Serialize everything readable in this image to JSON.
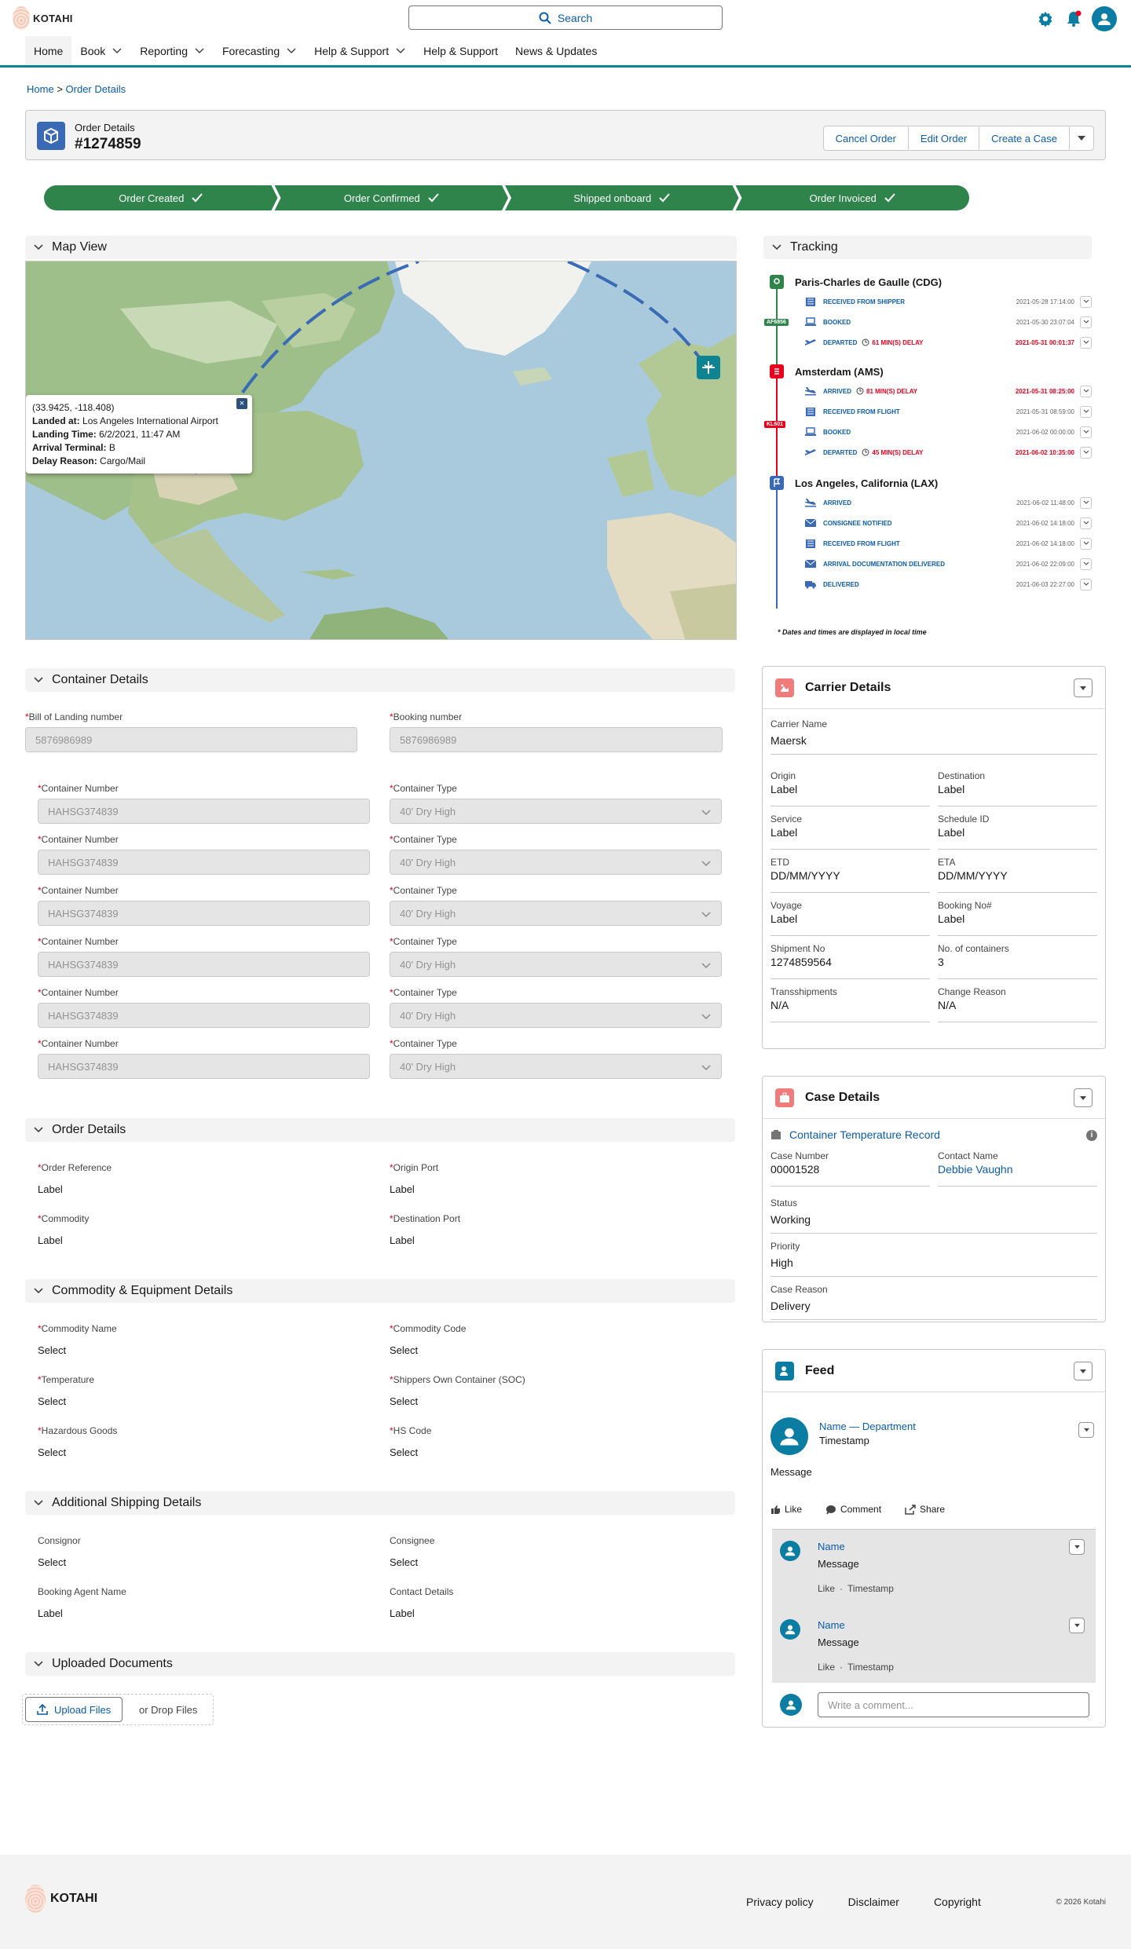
{
  "brand": {
    "name": "KOTAHI"
  },
  "header": {
    "search_placeholder": "Search"
  },
  "nav": {
    "items": [
      {
        "label": "Home",
        "active": true,
        "dropdown": false
      },
      {
        "label": "Book",
        "dropdown": true
      },
      {
        "label": "Reporting",
        "dropdown": true
      },
      {
        "label": "Forecasting",
        "dropdown": true
      },
      {
        "label": "Help & Support",
        "dropdown": true
      },
      {
        "label": "Help & Support",
        "dropdown": false
      },
      {
        "label": "News & Updates",
        "dropdown": false
      }
    ]
  },
  "breadcrumb": {
    "home": "Home",
    "separator": ">",
    "current": "Order Details"
  },
  "order": {
    "label": "Order Details",
    "number": "#1274859",
    "actions": [
      "Cancel Order",
      "Edit Order",
      "Create a Case"
    ]
  },
  "progress": {
    "steps": [
      "Order Created",
      "Order Confirmed",
      "Shipped onboard",
      "Order Invoiced"
    ],
    "color": "#2e844a"
  },
  "map": {
    "title": "Map View",
    "popup": {
      "coords": "(33.9425, -118.408)",
      "landed_label": "Landed at:",
      "landed_value": "Los Angeles International Airport",
      "time_label": "Landing Time:",
      "time_value": "6/2/2021, 11:47 AM",
      "terminal_label": "Arrival Terminal:",
      "terminal_value": "B",
      "delay_label": "Delay Reason:",
      "delay_value": "Cargo/Mail"
    }
  },
  "tracking": {
    "title": "Tracking",
    "locations": [
      {
        "name": "Paris-Charles de Gaulle (CDG)",
        "flight": "AF6856",
        "events": [
          {
            "label": "RECEIVED FROM SHIPPER",
            "time": "2021-05-28 17:14:00",
            "delay": ""
          },
          {
            "label": "BOOKED",
            "time": "2021-05-30 23:07:04",
            "delay": ""
          },
          {
            "label": "DEPARTED",
            "time": "2021-05-31 00:01:37",
            "delay": "61 MIN(S) DELAY"
          }
        ]
      },
      {
        "name": "Amsterdam (AMS)",
        "flight": "KL601",
        "events": [
          {
            "label": "ARRIVED",
            "time": "2021-05-31 08:25:00",
            "delay": "81 MIN(S) DELAY"
          },
          {
            "label": "RECEIVED FROM FLIGHT",
            "time": "2021-05-31 08:59:00",
            "delay": ""
          },
          {
            "label": "BOOKED",
            "time": "2021-06-02 00:00:00",
            "delay": ""
          },
          {
            "label": "DEPARTED",
            "time": "2021-06-02 10:35:00",
            "delay": "45 MIN(S) DELAY"
          }
        ]
      },
      {
        "name": "Los Angeles, California (LAX)",
        "flight": "",
        "events": [
          {
            "label": "ARRIVED",
            "time": "2021-06-02 11:48:00",
            "delay": ""
          },
          {
            "label": "CONSIGNEE NOTIFIED",
            "time": "2021-06-02 14:18:00",
            "delay": ""
          },
          {
            "label": "RECEIVED FROM FLIGHT",
            "time": "2021-06-02 14:18:00",
            "delay": ""
          },
          {
            "label": "ARRIVAL DOCUMENTATION DELIVERED",
            "time": "2021-06-02 22:09:00",
            "delay": ""
          },
          {
            "label": "DELIVERED",
            "time": "2021-06-03 22:27:00",
            "delay": ""
          }
        ]
      }
    ],
    "footnote": "* Dates and times are displayed in local time"
  },
  "container_details": {
    "title": "Container Details",
    "bill_label": "Bill of Landing number",
    "bill_value": "5876986989",
    "booking_label": "Booking number",
    "booking_value": "5876986989",
    "container_number_label": "Container Number",
    "container_type_label": "Container Type",
    "rows": [
      {
        "number": "HAHSG374839",
        "type": "40' Dry High"
      },
      {
        "number": "HAHSG374839",
        "type": "40' Dry High"
      },
      {
        "number": "HAHSG374839",
        "type": "40' Dry High"
      },
      {
        "number": "HAHSG374839",
        "type": "40' Dry High"
      },
      {
        "number": "HAHSG374839",
        "type": "40' Dry High"
      },
      {
        "number": "HAHSG374839",
        "type": "40' Dry High"
      }
    ]
  },
  "order_details": {
    "title": "Order Details",
    "fields": [
      {
        "label": "Order Reference",
        "value": "Label",
        "required": true
      },
      {
        "label": "Origin Port",
        "value": "Label",
        "required": true
      },
      {
        "label": "Commodity",
        "value": "Label",
        "required": true
      },
      {
        "label": "Destination Port",
        "value": "Label",
        "required": true
      }
    ]
  },
  "commodity_details": {
    "title": "Commodity & Equipment Details",
    "fields": [
      {
        "label": "Commodity Name",
        "value": "Select",
        "required": true
      },
      {
        "label": "Commodity Code",
        "value": "Select",
        "required": true
      },
      {
        "label": "Temperature",
        "value": "Select",
        "required": true
      },
      {
        "label": "Shippers Own Container (SOC)",
        "value": "Select",
        "required": true
      },
      {
        "label": "Hazardous Goods",
        "value": "Select",
        "required": true
      },
      {
        "label": "HS Code",
        "value": "Select",
        "required": true
      }
    ]
  },
  "shipping_details": {
    "title": "Additional Shipping Details",
    "fields": [
      {
        "label": "Consignor",
        "value": "Select"
      },
      {
        "label": "Consignee",
        "value": "Select"
      },
      {
        "label": "Booking Agent Name",
        "value": "Label"
      },
      {
        "label": "Contact Details",
        "value": "Label"
      }
    ]
  },
  "uploads": {
    "title": "Uploaded Documents",
    "button": "Upload Files",
    "drop": "or Drop Files"
  },
  "carrier": {
    "title": "Carrier Details",
    "name_label": "Carrier Name",
    "name_value": "Maersk",
    "fields": [
      {
        "label": "Origin",
        "value": "Label"
      },
      {
        "label": "Destination",
        "value": "Label"
      },
      {
        "label": "Service",
        "value": "Label"
      },
      {
        "label": "Schedule ID",
        "value": "Label"
      },
      {
        "label": "ETD",
        "value": "DD/MM/YYYY"
      },
      {
        "label": "ETA",
        "value": "DD/MM/YYYY"
      },
      {
        "label": "Voyage",
        "value": "Label"
      },
      {
        "label": "Booking No#",
        "value": "Label"
      },
      {
        "label": "Shipment No",
        "value": "1274859564"
      },
      {
        "label": "No. of containers",
        "value": "3"
      },
      {
        "label": "Transshipments",
        "value": "N/A"
      },
      {
        "label": "Change Reason",
        "value": "N/A"
      }
    ]
  },
  "case": {
    "title": "Case Details",
    "record": "Container Temperature Record",
    "number_label": "Case Number",
    "number_value": "00001528",
    "contact_label": "Contact Name",
    "contact_value": "Debbie Vaughn",
    "status_label": "Status",
    "status_value": "Working",
    "priority_label": "Priority",
    "priority_value": "High",
    "reason_label": "Case Reason",
    "reason_value": "Delivery"
  },
  "feed": {
    "title": "Feed",
    "post": {
      "author": "Name — Department",
      "timestamp": "Timestamp",
      "message": "Message"
    },
    "actions": [
      "Like",
      "Comment",
      "Share"
    ],
    "comments": [
      {
        "name": "Name",
        "message": "Message",
        "like": "Like",
        "dot": "·",
        "timestamp": "Timestamp"
      },
      {
        "name": "Name",
        "message": "Message",
        "like": "Like",
        "dot": "·",
        "timestamp": "Timestamp"
      }
    ],
    "comment_placeholder": "Write a comment..."
  },
  "footer": {
    "links": [
      "Privacy policy",
      "Disclaimer",
      "Copyright"
    ],
    "copyright": "© 2026 Kotahi"
  },
  "colors": {
    "accent": "#0e8391",
    "link": "#0b5cab",
    "success": "#2e844a",
    "danger": "#ea001e"
  }
}
